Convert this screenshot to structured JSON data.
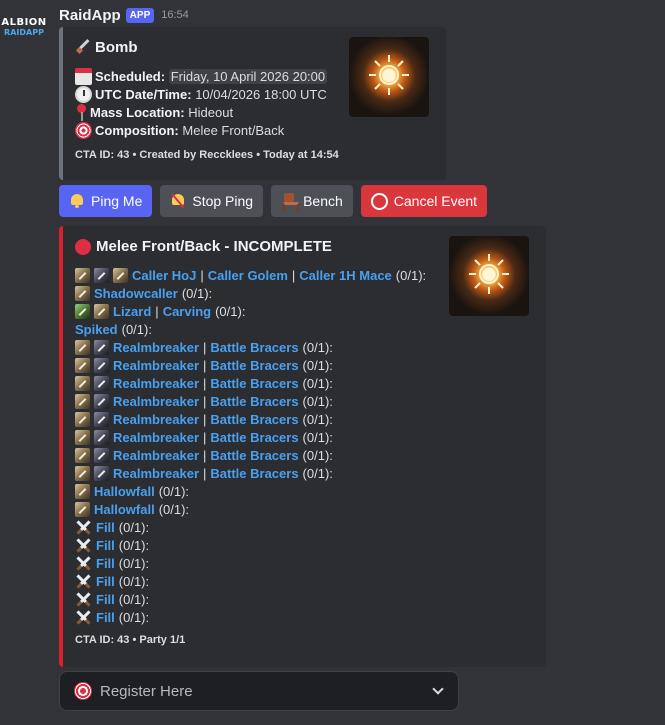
{
  "message": {
    "app_name": "RaidApp",
    "app_tag": "APP",
    "timestamp": "16:54",
    "avatar": {
      "line1": "ALBION",
      "line2": "RAIDAPP"
    }
  },
  "event_embed": {
    "title": "Bomb",
    "title_icon": "dagger-icon",
    "fields": [
      {
        "icon": "calendar-icon",
        "label": "Scheduled:",
        "value": "Friday, 10 April 2026 20:00"
      },
      {
        "icon": "clock-icon",
        "label": "UTC Date/Time:",
        "value": "10/04/2026 18:00 UTC"
      },
      {
        "icon": "pin-icon",
        "label": "Mass Location:",
        "value": "Hideout"
      },
      {
        "icon": "target-icon",
        "label": "Composition:",
        "value": "Melee Front/Back"
      }
    ],
    "footer": {
      "cta": "CTA ID: 43",
      "created": "Created by Reccklees",
      "when": "Today at 14:54"
    }
  },
  "buttons": {
    "ping_me": "Ping Me",
    "stop_ping": "Stop Ping",
    "bench": "Bench",
    "cancel_event": "Cancel Event"
  },
  "comp_embed": {
    "title": "Melee Front/Back - INCOMPLETE",
    "status_color": "#dd2e44",
    "rows": [
      {
        "icons": [
          "item",
          "dark",
          "item"
        ],
        "links": [
          "Caller HoJ",
          "Caller Golem",
          "Caller 1H Mace"
        ],
        "count": "(0/1):"
      },
      {
        "icons": [
          "item"
        ],
        "links": [
          "Shadowcaller"
        ],
        "count": "(0/1):"
      },
      {
        "icons": [
          "green",
          "item"
        ],
        "links": [
          "Lizard",
          "Carving"
        ],
        "count": "(0/1):"
      },
      {
        "icons": [],
        "links": [
          "Spiked"
        ],
        "count": "(0/1):"
      },
      {
        "icons": [
          "item",
          "dark"
        ],
        "links": [
          "Realmbreaker",
          "Battle Bracers"
        ],
        "count": "(0/1):"
      },
      {
        "icons": [
          "item",
          "dark"
        ],
        "links": [
          "Realmbreaker",
          "Battle Bracers"
        ],
        "count": "(0/1):"
      },
      {
        "icons": [
          "item",
          "dark"
        ],
        "links": [
          "Realmbreaker",
          "Battle Bracers"
        ],
        "count": "(0/1):"
      },
      {
        "icons": [
          "item",
          "dark"
        ],
        "links": [
          "Realmbreaker",
          "Battle Bracers"
        ],
        "count": "(0/1):"
      },
      {
        "icons": [
          "item",
          "dark"
        ],
        "links": [
          "Realmbreaker",
          "Battle Bracers"
        ],
        "count": "(0/1):"
      },
      {
        "icons": [
          "item",
          "dark"
        ],
        "links": [
          "Realmbreaker",
          "Battle Bracers"
        ],
        "count": "(0/1):"
      },
      {
        "icons": [
          "item",
          "dark"
        ],
        "links": [
          "Realmbreaker",
          "Battle Bracers"
        ],
        "count": "(0/1):"
      },
      {
        "icons": [
          "item",
          "dark"
        ],
        "links": [
          "Realmbreaker",
          "Battle Bracers"
        ],
        "count": "(0/1):"
      },
      {
        "icons": [
          "item"
        ],
        "links": [
          "Hallowfall"
        ],
        "count": "(0/1):"
      },
      {
        "icons": [
          "item"
        ],
        "links": [
          "Hallowfall"
        ],
        "count": "(0/1):"
      },
      {
        "icons": [
          "swords"
        ],
        "links": [
          "Fill"
        ],
        "count": "(0/1):"
      },
      {
        "icons": [
          "swords"
        ],
        "links": [
          "Fill"
        ],
        "count": "(0/1):"
      },
      {
        "icons": [
          "swords"
        ],
        "links": [
          "Fill"
        ],
        "count": "(0/1):"
      },
      {
        "icons": [
          "swords"
        ],
        "links": [
          "Fill"
        ],
        "count": "(0/1):"
      },
      {
        "icons": [
          "swords"
        ],
        "links": [
          "Fill"
        ],
        "count": "(0/1):"
      },
      {
        "icons": [
          "swords"
        ],
        "links": [
          "Fill"
        ],
        "count": "(0/1):"
      }
    ],
    "footer": {
      "cta": "CTA ID: 43",
      "party": "Party 1/1"
    }
  },
  "select": {
    "placeholder": "Register Here",
    "icon": "dart-icon"
  }
}
